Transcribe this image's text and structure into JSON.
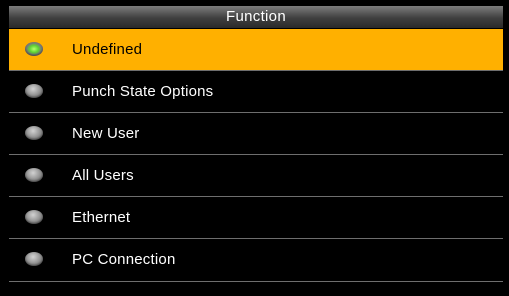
{
  "header": {
    "title": "Function"
  },
  "menu": {
    "selected_index": 0,
    "items": [
      {
        "label": "Undefined"
      },
      {
        "label": "Punch State Options"
      },
      {
        "label": "New User"
      },
      {
        "label": "All Users"
      },
      {
        "label": "Ethernet"
      },
      {
        "label": "PC Connection"
      }
    ]
  },
  "colors": {
    "selected_background": "#ffb000",
    "background": "#000000",
    "selected_indicator": "#5fd431",
    "indicator": "#9a9a9a"
  }
}
